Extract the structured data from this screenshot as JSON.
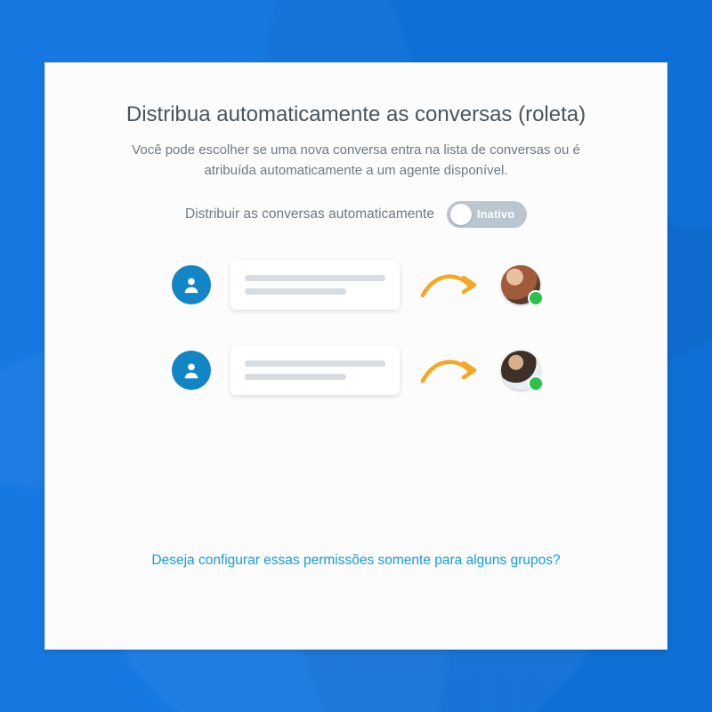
{
  "title": "Distribua automaticamente as conversas (roleta)",
  "subtitle": "Você pode escolher se uma nova conversa entra na lista de conversas ou é atribuída automaticamente a um agente disponível.",
  "toggle": {
    "label": "Distribuir as conversas automaticamente",
    "state_label": "Inativo",
    "active": false
  },
  "illustration": {
    "rows": [
      {
        "icon": "person-icon",
        "avatar_status": "online"
      },
      {
        "icon": "person-icon",
        "avatar_status": "online"
      }
    ]
  },
  "footer_link": "Deseja configurar essas permissões somente para alguns grupos?",
  "colors": {
    "background": "#0f75e0",
    "panel": "#fcfcfc",
    "accent": "#1285c4",
    "toggle_track": "#b9c6cf",
    "status_online": "#29c24a",
    "link": "#0f9fe0",
    "arrow": "#f5a623"
  }
}
